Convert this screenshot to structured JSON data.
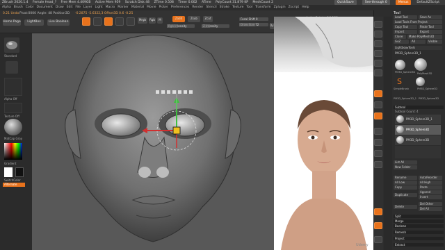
{
  "titlebar": {
    "items": [
      "ZBrush 2020.1.4",
      "Female Head_?",
      "Free Mem 4.409GB",
      "Active Mem 959",
      "Scratch Disk 48",
      "ZTime 0.508",
      "Timer 0.002",
      "ATime",
      "PolyCount 31.879 KP",
      "MeshCount 2"
    ],
    "quicksave": "QuickSave",
    "seethrough": "See-through 0",
    "menus": "Menus",
    "script": "DefaultZScript"
  },
  "menubar": [
    "Alpha",
    "Brush",
    "Color",
    "Document",
    "Draw",
    "Edit",
    "File",
    "Layer",
    "Light",
    "Macro",
    "Marker",
    "Material",
    "Movie",
    "Picker",
    "Preferences",
    "Render",
    "Stencil",
    "Stroke",
    "Texture",
    "Tool",
    "Transform",
    "Zplugin",
    "Zscript",
    "Help"
  ],
  "toolbar": {
    "status": "0.21 Undo",
    "pivot_info": "Pivot:0000 Angle: 48 Position3D",
    "coords": "-0.2875 -5.6322,3 Offset3D 0.6 -0.25",
    "home_page": "Home Page",
    "lightbox": "LightBox",
    "live_boolean": "Live Boolean",
    "edit": "Edit",
    "draw": "Draw",
    "move": "Move",
    "scale": "Scale",
    "rotate": "Rotate",
    "mrgb": "Mrgb",
    "rgb": "Rgb",
    "m": "M",
    "zadd": "Zadd",
    "zsub": "Zsub",
    "zcut": "Zcut",
    "rgb_intensity": "Rgb Intensity",
    "z_intensity": "Z Intensity",
    "focal_shift": "Focal Shift 0",
    "draw_size": "Draw Size 72",
    "dynamic": "Dynamic",
    "active_points": "ActivePoints: 16,132",
    "total_points": "TotalPoints: 32,263"
  },
  "lefttray": {
    "alpha_label": "Alpha Off",
    "texture_label": "Texture Off",
    "matcap_label": "MatCap Gray",
    "gradient": "Gradient",
    "switch_color": "SwitchColor",
    "alternate": "Alternate",
    "standard": "Standard"
  },
  "rightpanel": {
    "tool_title": "Tool",
    "load_tool": "Load Tool",
    "save_as": "Save As",
    "load_tools_project": "Load Tools From Project",
    "copy_tool": "Copy Tool",
    "paste_tool": "Paste Tool",
    "import": "Import",
    "export": "Export",
    "clone": "Clone",
    "make_polymesh": "Make PolyMesh3D",
    "goz": "GoZ",
    "all": "All",
    "visible": "Visible",
    "lightbox_tools": "Lightbox▸Tools",
    "current_tool": "PM3D_Sphere3D_1",
    "thumbs": [
      "PM3D_Sphere3D",
      "PolyMesh3D",
      "SimpleBrush",
      "PM3D_Sphere3D",
      "PM3D_Sphere3D_1",
      "PM3D_Sphere3D"
    ],
    "subtool": "Subtool",
    "subtool_count": "Subtool Count: 4",
    "subtools": [
      "PM3D_Sphere3D_1",
      "PM3D_Sphere3D",
      "PM3D_Sphere3D"
    ],
    "list_all": "List All",
    "new_folder": "New Folder",
    "rename": "Rename",
    "autoreorder": "AutoReorder",
    "all_low": "All Low",
    "all_high": "All High",
    "copy": "Copy",
    "paste": "Paste",
    "duplicate": "Duplicate",
    "append": "Append",
    "insert": "Insert",
    "delete": "Delete",
    "del_other": "Del Other",
    "del_all": "Del All",
    "split": "Split",
    "merge": "Merge",
    "boolean": "Boolean",
    "remesh": "Remesh",
    "project": "Project",
    "extract": "Extract"
  },
  "rightshelf": [
    "BPR",
    "SPix 3",
    "Scroll",
    "Zoom",
    "Actual",
    "AAHalf",
    "Persp",
    "Floor",
    "Local",
    "Frame",
    "Move",
    "Zoom3D",
    "Rotate",
    "Transp",
    "Ghost",
    "Solo",
    "Xpose"
  ],
  "watermark": "Udemy",
  "colors": {
    "accent": "#e8721c",
    "panel": "#2d2d2d",
    "canvas": "#575757"
  }
}
